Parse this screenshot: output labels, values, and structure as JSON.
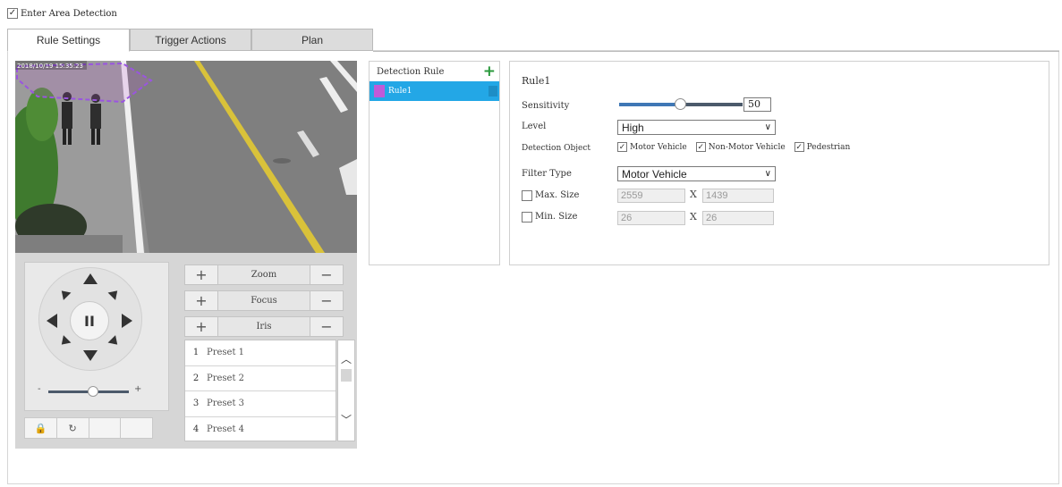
{
  "header": {
    "enable_label": "Enter Area Detection",
    "enable_checked": true
  },
  "tabs": [
    {
      "label": "Rule Settings",
      "active": true
    },
    {
      "label": "Trigger Actions",
      "active": false
    },
    {
      "label": "Plan",
      "active": false
    }
  ],
  "video": {
    "overlay_text": "2018/10/19 15:35:23"
  },
  "ptz": {
    "center_glyph": "II",
    "speed_minus": "-",
    "speed_plus": "+",
    "speed_level": 0.5,
    "controls": [
      {
        "label": "Zoom",
        "plus": "+",
        "minus": "−"
      },
      {
        "label": "Focus",
        "plus": "+",
        "minus": "−"
      },
      {
        "label": "Iris",
        "plus": "+",
        "minus": "−"
      }
    ],
    "presets": [
      {
        "num": "1",
        "name": "Preset 1"
      },
      {
        "num": "2",
        "name": "Preset 2"
      },
      {
        "num": "3",
        "name": "Preset 3"
      },
      {
        "num": "4",
        "name": "Preset 4"
      }
    ],
    "tools": [
      "lock-camera-icon",
      "refresh-icon",
      "",
      ""
    ]
  },
  "rules": {
    "header": "Detection Rule",
    "items": [
      {
        "name": "Rule1",
        "color": "#c05ad8",
        "selected": true
      }
    ]
  },
  "settings": {
    "title": "Rule1",
    "sensitivity_label": "Sensitivity",
    "sensitivity_value": "50",
    "level_label": "Level",
    "level_value": "High",
    "detection_object_label": "Detection Object",
    "objects": [
      {
        "label": "Motor Vehicle",
        "checked": true
      },
      {
        "label": "Non-Motor Vehicle",
        "checked": true
      },
      {
        "label": "Pedestrian",
        "checked": true
      }
    ],
    "filter_type_label": "Filter Type",
    "filter_type_value": "Motor Vehicle",
    "max_size_label": "Max. Size",
    "max_w": "2559",
    "max_h": "1439",
    "min_size_label": "Min. Size",
    "min_w": "26",
    "min_h": "26",
    "x_sep": "X"
  },
  "colors": {
    "accent": "#23a7e6",
    "rule_color": "#c05ad8",
    "add_green": "#2b9a3d"
  }
}
